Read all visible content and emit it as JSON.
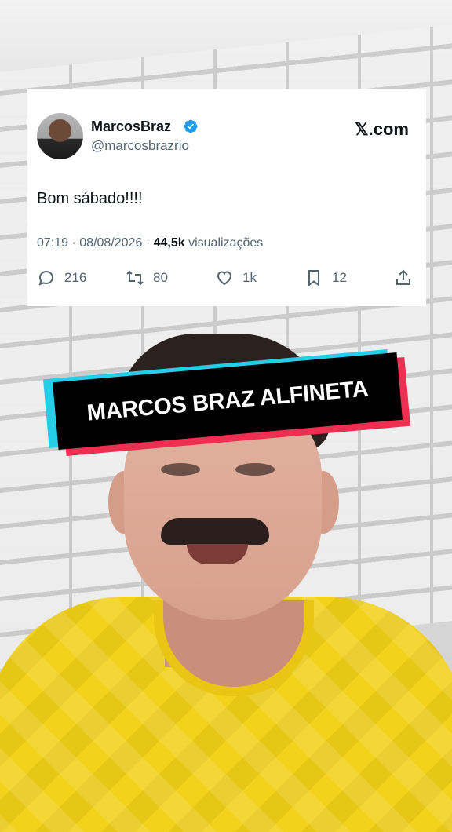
{
  "tweet": {
    "display_name": "MarcosBraz",
    "handle": "@marcosbrazrio",
    "source": "𝕏.com",
    "text": "Bom sábado!!!!",
    "time": "07:19",
    "date": "08/08/2026",
    "views_count": "44,5k",
    "views_label": "visualizações",
    "replies": "216",
    "retweets": "80",
    "likes": "1k",
    "bookmarks": "12",
    "verified_color": "#1d9bf0"
  },
  "banner": {
    "text": "MARCOS BRAZ ALFINETA",
    "colors": {
      "cyan": "#25cde6",
      "pink": "#ee2f52",
      "black": "#000000"
    }
  }
}
